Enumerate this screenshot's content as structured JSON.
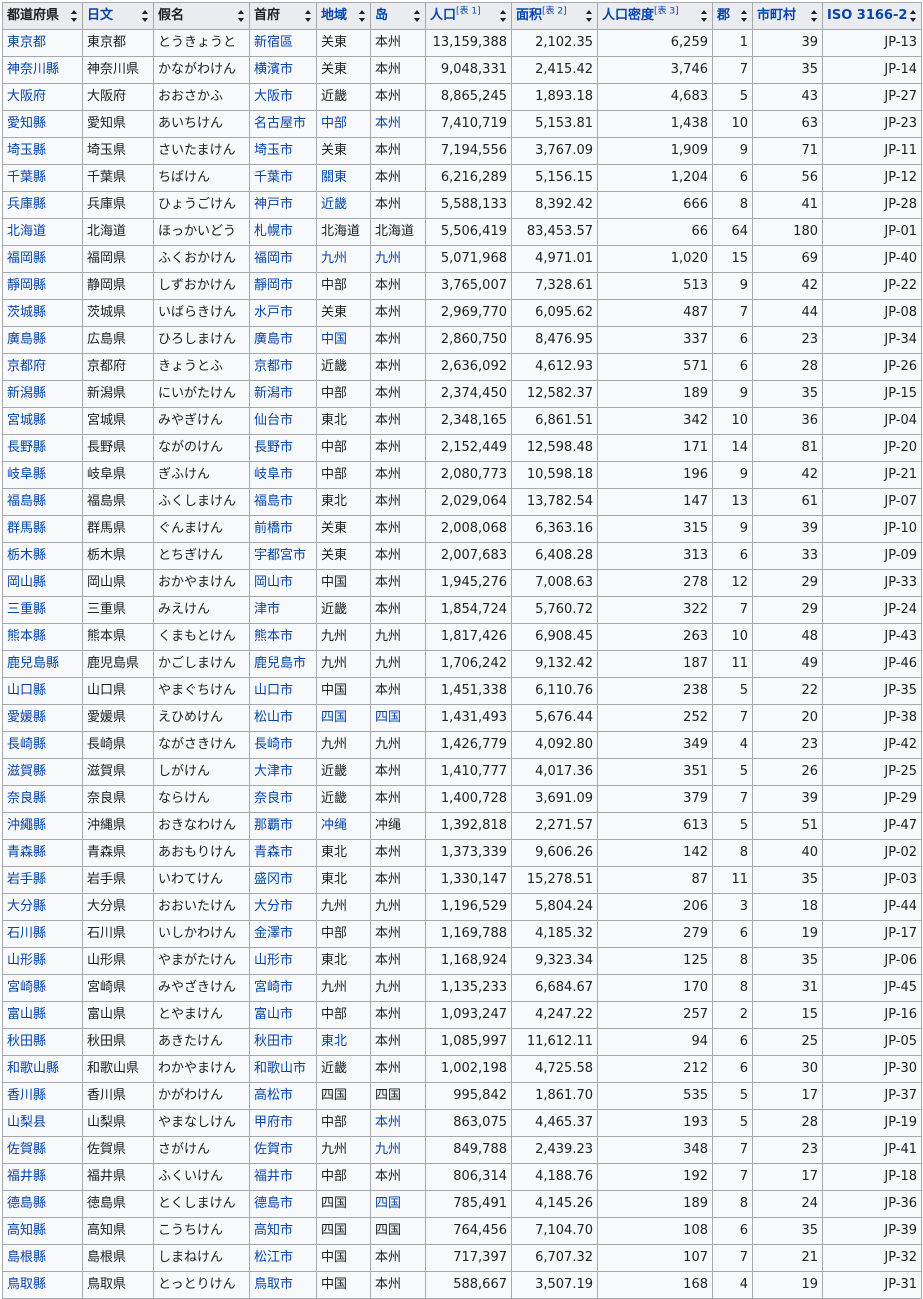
{
  "headers": [
    {
      "key": "pref",
      "label": "都道府県",
      "link": false,
      "sup": ""
    },
    {
      "key": "jp",
      "label": "日文",
      "link": true,
      "sup": ""
    },
    {
      "key": "kana",
      "label": "假名",
      "link": false,
      "sup": ""
    },
    {
      "key": "capital",
      "label": "首府",
      "link": false,
      "sup": ""
    },
    {
      "key": "region",
      "label": "地域",
      "link": true,
      "sup": ""
    },
    {
      "key": "island",
      "label": "岛",
      "link": true,
      "sup": ""
    },
    {
      "key": "pop",
      "label": "人口",
      "link": true,
      "sup": "[表 1]"
    },
    {
      "key": "area",
      "label": "面积",
      "link": true,
      "sup": "[表 2]"
    },
    {
      "key": "density",
      "label": "人口密度",
      "link": true,
      "sup": "[表 3]"
    },
    {
      "key": "districts",
      "label": "郡",
      "link": true,
      "sup": ""
    },
    {
      "key": "munis",
      "label": "市町村",
      "link": true,
      "sup": ""
    },
    {
      "key": "iso",
      "label": "ISO 3166-2",
      "link": true,
      "sup": ""
    }
  ],
  "rows": [
    {
      "pref": "東京都",
      "jp": "東京都",
      "kana": "とうきょうと",
      "capital": "新宿區",
      "region": "关東",
      "region_link": false,
      "island": "本州",
      "island_link": false,
      "pop": "13,159,388",
      "area": "2,102.35",
      "density": "6,259",
      "districts": "1",
      "munis": "39",
      "iso": "JP-13"
    },
    {
      "pref": "神奈川縣",
      "jp": "神奈川県",
      "kana": "かながわけん",
      "capital": "横濱市",
      "region": "关東",
      "region_link": false,
      "island": "本州",
      "island_link": false,
      "pop": "9,048,331",
      "area": "2,415.42",
      "density": "3,746",
      "districts": "7",
      "munis": "35",
      "iso": "JP-14"
    },
    {
      "pref": "大阪府",
      "jp": "大阪府",
      "kana": "おおさかふ",
      "capital": "大阪市",
      "region": "近畿",
      "region_link": false,
      "island": "本州",
      "island_link": false,
      "pop": "8,865,245",
      "area": "1,893.18",
      "density": "4,683",
      "districts": "5",
      "munis": "43",
      "iso": "JP-27"
    },
    {
      "pref": "愛知縣",
      "jp": "愛知県",
      "kana": "あいちけん",
      "capital": "名古屋市",
      "region": "中部",
      "region_link": true,
      "island": "本州",
      "island_link": true,
      "pop": "7,410,719",
      "area": "5,153.81",
      "density": "1,438",
      "districts": "10",
      "munis": "63",
      "iso": "JP-23"
    },
    {
      "pref": "埼玉縣",
      "jp": "埼玉県",
      "kana": "さいたまけん",
      "capital": "埼玉市",
      "region": "关東",
      "region_link": false,
      "island": "本州",
      "island_link": false,
      "pop": "7,194,556",
      "area": "3,767.09",
      "density": "1,909",
      "districts": "9",
      "munis": "71",
      "iso": "JP-11"
    },
    {
      "pref": "千葉縣",
      "jp": "千葉県",
      "kana": "ちばけん",
      "capital": "千葉市",
      "region": "關東",
      "region_link": true,
      "island": "本州",
      "island_link": false,
      "pop": "6,216,289",
      "area": "5,156.15",
      "density": "1,204",
      "districts": "6",
      "munis": "56",
      "iso": "JP-12"
    },
    {
      "pref": "兵庫縣",
      "jp": "兵庫県",
      "kana": "ひょうごけん",
      "capital": "神戸市",
      "region": "近畿",
      "region_link": true,
      "island": "本州",
      "island_link": false,
      "pop": "5,588,133",
      "area": "8,392.42",
      "density": "666",
      "districts": "8",
      "munis": "41",
      "iso": "JP-28"
    },
    {
      "pref": "北海道",
      "jp": "北海道",
      "kana": "ほっかいどう",
      "capital": "札幌市",
      "region": "北海道",
      "region_link": false,
      "island": "北海道",
      "island_link": false,
      "pop": "5,506,419",
      "area": "83,453.57",
      "density": "66",
      "districts": "64",
      "munis": "180",
      "iso": "JP-01"
    },
    {
      "pref": "福岡縣",
      "jp": "福岡県",
      "kana": "ふくおかけん",
      "capital": "福岡市",
      "region": "九州",
      "region_link": true,
      "island": "九州",
      "island_link": true,
      "pop": "5,071,968",
      "area": "4,971.01",
      "density": "1,020",
      "districts": "15",
      "munis": "69",
      "iso": "JP-40"
    },
    {
      "pref": "靜岡縣",
      "jp": "静岡県",
      "kana": "しずおかけん",
      "capital": "靜岡市",
      "region": "中部",
      "region_link": false,
      "island": "本州",
      "island_link": false,
      "pop": "3,765,007",
      "area": "7,328.61",
      "density": "513",
      "districts": "9",
      "munis": "42",
      "iso": "JP-22"
    },
    {
      "pref": "茨城縣",
      "jp": "茨城県",
      "kana": "いばらきけん",
      "capital": "水戸市",
      "region": "关東",
      "region_link": false,
      "island": "本州",
      "island_link": false,
      "pop": "2,969,770",
      "area": "6,095.62",
      "density": "487",
      "districts": "7",
      "munis": "44",
      "iso": "JP-08"
    },
    {
      "pref": "廣島縣",
      "jp": "広島県",
      "kana": "ひろしまけん",
      "capital": "廣島市",
      "region": "中国",
      "region_link": true,
      "island": "本州",
      "island_link": false,
      "pop": "2,860,750",
      "area": "8,476.95",
      "density": "337",
      "districts": "6",
      "munis": "23",
      "iso": "JP-34"
    },
    {
      "pref": "京都府",
      "jp": "京都府",
      "kana": "きょうとふ",
      "capital": "京都市",
      "region": "近畿",
      "region_link": false,
      "island": "本州",
      "island_link": false,
      "pop": "2,636,092",
      "area": "4,612.93",
      "density": "571",
      "districts": "6",
      "munis": "28",
      "iso": "JP-26"
    },
    {
      "pref": "新潟縣",
      "jp": "新潟県",
      "kana": "にいがたけん",
      "capital": "新潟市",
      "region": "中部",
      "region_link": false,
      "island": "本州",
      "island_link": false,
      "pop": "2,374,450",
      "area": "12,582.37",
      "density": "189",
      "districts": "9",
      "munis": "35",
      "iso": "JP-15"
    },
    {
      "pref": "宮城縣",
      "jp": "宮城県",
      "kana": "みやぎけん",
      "capital": "仙台市",
      "region": "東北",
      "region_link": false,
      "island": "本州",
      "island_link": false,
      "pop": "2,348,165",
      "area": "6,861.51",
      "density": "342",
      "districts": "10",
      "munis": "36",
      "iso": "JP-04"
    },
    {
      "pref": "長野縣",
      "jp": "長野県",
      "kana": "ながのけん",
      "capital": "長野市",
      "region": "中部",
      "region_link": false,
      "island": "本州",
      "island_link": false,
      "pop": "2,152,449",
      "area": "12,598.48",
      "density": "171",
      "districts": "14",
      "munis": "81",
      "iso": "JP-20"
    },
    {
      "pref": "岐阜縣",
      "jp": "岐阜県",
      "kana": "ぎふけん",
      "capital": "岐阜市",
      "region": "中部",
      "region_link": false,
      "island": "本州",
      "island_link": false,
      "pop": "2,080,773",
      "area": "10,598.18",
      "density": "196",
      "districts": "9",
      "munis": "42",
      "iso": "JP-21"
    },
    {
      "pref": "福島縣",
      "jp": "福島県",
      "kana": "ふくしまけん",
      "capital": "福島市",
      "region": "東北",
      "region_link": false,
      "island": "本州",
      "island_link": false,
      "pop": "2,029,064",
      "area": "13,782.54",
      "density": "147",
      "districts": "13",
      "munis": "61",
      "iso": "JP-07"
    },
    {
      "pref": "群馬縣",
      "jp": "群馬県",
      "kana": "ぐんまけん",
      "capital": "前橋市",
      "region": "关東",
      "region_link": false,
      "island": "本州",
      "island_link": false,
      "pop": "2,008,068",
      "area": "6,363.16",
      "density": "315",
      "districts": "9",
      "munis": "39",
      "iso": "JP-10"
    },
    {
      "pref": "栃木縣",
      "jp": "栃木県",
      "kana": "とちぎけん",
      "capital": "宇都宮市",
      "region": "关東",
      "region_link": false,
      "island": "本州",
      "island_link": false,
      "pop": "2,007,683",
      "area": "6,408.28",
      "density": "313",
      "districts": "6",
      "munis": "33",
      "iso": "JP-09"
    },
    {
      "pref": "岡山縣",
      "jp": "岡山県",
      "kana": "おかやまけん",
      "capital": "岡山市",
      "region": "中国",
      "region_link": false,
      "island": "本州",
      "island_link": false,
      "pop": "1,945,276",
      "area": "7,008.63",
      "density": "278",
      "districts": "12",
      "munis": "29",
      "iso": "JP-33"
    },
    {
      "pref": "三重縣",
      "jp": "三重県",
      "kana": "みえけん",
      "capital": "津市",
      "region": "近畿",
      "region_link": false,
      "island": "本州",
      "island_link": false,
      "pop": "1,854,724",
      "area": "5,760.72",
      "density": "322",
      "districts": "7",
      "munis": "29",
      "iso": "JP-24"
    },
    {
      "pref": "熊本縣",
      "jp": "熊本県",
      "kana": "くまもとけん",
      "capital": "熊本市",
      "region": "九州",
      "region_link": false,
      "island": "九州",
      "island_link": false,
      "pop": "1,817,426",
      "area": "6,908.45",
      "density": "263",
      "districts": "10",
      "munis": "48",
      "iso": "JP-43"
    },
    {
      "pref": "鹿兒島縣",
      "jp": "鹿児島県",
      "kana": "かごしまけん",
      "capital": "鹿兒島市",
      "region": "九州",
      "region_link": false,
      "island": "九州",
      "island_link": false,
      "pop": "1,706,242",
      "area": "9,132.42",
      "density": "187",
      "districts": "11",
      "munis": "49",
      "iso": "JP-46"
    },
    {
      "pref": "山口縣",
      "jp": "山口県",
      "kana": "やまぐちけん",
      "capital": "山口市",
      "region": "中国",
      "region_link": false,
      "island": "本州",
      "island_link": false,
      "pop": "1,451,338",
      "area": "6,110.76",
      "density": "238",
      "districts": "5",
      "munis": "22",
      "iso": "JP-35"
    },
    {
      "pref": "愛媛縣",
      "jp": "愛媛県",
      "kana": "えひめけん",
      "capital": "松山市",
      "region": "四国",
      "region_link": true,
      "island": "四国",
      "island_link": true,
      "pop": "1,431,493",
      "area": "5,676.44",
      "density": "252",
      "districts": "7",
      "munis": "20",
      "iso": "JP-38"
    },
    {
      "pref": "長崎縣",
      "jp": "長崎県",
      "kana": "ながさきけん",
      "capital": "長崎市",
      "region": "九州",
      "region_link": false,
      "island": "九州",
      "island_link": false,
      "pop": "1,426,779",
      "area": "4,092.80",
      "density": "349",
      "districts": "4",
      "munis": "23",
      "iso": "JP-42"
    },
    {
      "pref": "滋賀縣",
      "jp": "滋賀県",
      "kana": "しがけん",
      "capital": "大津市",
      "region": "近畿",
      "region_link": false,
      "island": "本州",
      "island_link": false,
      "pop": "1,410,777",
      "area": "4,017.36",
      "density": "351",
      "districts": "5",
      "munis": "26",
      "iso": "JP-25"
    },
    {
      "pref": "奈良縣",
      "jp": "奈良県",
      "kana": "ならけん",
      "capital": "奈良市",
      "region": "近畿",
      "region_link": false,
      "island": "本州",
      "island_link": false,
      "pop": "1,400,728",
      "area": "3,691.09",
      "density": "379",
      "districts": "7",
      "munis": "39",
      "iso": "JP-29"
    },
    {
      "pref": "沖繩縣",
      "jp": "沖縄県",
      "kana": "おきなわけん",
      "capital": "那覇市",
      "region": "冲绳",
      "region_link": true,
      "island": "冲绳",
      "island_link": false,
      "pop": "1,392,818",
      "area": "2,271.57",
      "density": "613",
      "districts": "5",
      "munis": "51",
      "iso": "JP-47"
    },
    {
      "pref": "青森縣",
      "jp": "青森県",
      "kana": "あおもりけん",
      "capital": "青森市",
      "region": "東北",
      "region_link": false,
      "island": "本州",
      "island_link": false,
      "pop": "1,373,339",
      "area": "9,606.26",
      "density": "142",
      "districts": "8",
      "munis": "40",
      "iso": "JP-02"
    },
    {
      "pref": "岩手縣",
      "jp": "岩手県",
      "kana": "いわてけん",
      "capital": "盛冈市",
      "region": "東北",
      "region_link": false,
      "island": "本州",
      "island_link": false,
      "pop": "1,330,147",
      "area": "15,278.51",
      "density": "87",
      "districts": "11",
      "munis": "35",
      "iso": "JP-03"
    },
    {
      "pref": "大分縣",
      "jp": "大分県",
      "kana": "おおいたけん",
      "capital": "大分市",
      "region": "九州",
      "region_link": false,
      "island": "九州",
      "island_link": false,
      "pop": "1,196,529",
      "area": "5,804.24",
      "density": "206",
      "districts": "3",
      "munis": "18",
      "iso": "JP-44"
    },
    {
      "pref": "石川縣",
      "jp": "石川県",
      "kana": "いしかわけん",
      "capital": "金澤市",
      "region": "中部",
      "region_link": false,
      "island": "本州",
      "island_link": false,
      "pop": "1,169,788",
      "area": "4,185.32",
      "density": "279",
      "districts": "6",
      "munis": "19",
      "iso": "JP-17"
    },
    {
      "pref": "山形縣",
      "jp": "山形県",
      "kana": "やまがたけん",
      "capital": "山形市",
      "region": "東北",
      "region_link": false,
      "island": "本州",
      "island_link": false,
      "pop": "1,168,924",
      "area": "9,323.34",
      "density": "125",
      "districts": "8",
      "munis": "35",
      "iso": "JP-06"
    },
    {
      "pref": "宮崎縣",
      "jp": "宮崎県",
      "kana": "みやざきけん",
      "capital": "宮崎市",
      "region": "九州",
      "region_link": false,
      "island": "九州",
      "island_link": false,
      "pop": "1,135,233",
      "area": "6,684.67",
      "density": "170",
      "districts": "8",
      "munis": "31",
      "iso": "JP-45"
    },
    {
      "pref": "富山縣",
      "jp": "富山県",
      "kana": "とやまけん",
      "capital": "富山市",
      "region": "中部",
      "region_link": false,
      "island": "本州",
      "island_link": false,
      "pop": "1,093,247",
      "area": "4,247.22",
      "density": "257",
      "districts": "2",
      "munis": "15",
      "iso": "JP-16"
    },
    {
      "pref": "秋田縣",
      "jp": "秋田県",
      "kana": "あきたけん",
      "capital": "秋田市",
      "region": "東北",
      "region_link": true,
      "island": "本州",
      "island_link": false,
      "pop": "1,085,997",
      "area": "11,612.11",
      "density": "94",
      "districts": "6",
      "munis": "25",
      "iso": "JP-05"
    },
    {
      "pref": "和歌山縣",
      "jp": "和歌山県",
      "kana": "わかやまけん",
      "capital": "和歌山市",
      "region": "近畿",
      "region_link": false,
      "island": "本州",
      "island_link": false,
      "pop": "1,002,198",
      "area": "4,725.58",
      "density": "212",
      "districts": "6",
      "munis": "30",
      "iso": "JP-30"
    },
    {
      "pref": "香川縣",
      "jp": "香川県",
      "kana": "かがわけん",
      "capital": "高松市",
      "region": "四国",
      "region_link": false,
      "island": "四国",
      "island_link": false,
      "pop": "995,842",
      "area": "1,861.70",
      "density": "535",
      "districts": "5",
      "munis": "17",
      "iso": "JP-37"
    },
    {
      "pref": "山梨县",
      "jp": "山梨県",
      "kana": "やまなしけん",
      "capital": "甲府市",
      "region": "中部",
      "region_link": false,
      "island": "本州",
      "island_link": true,
      "pop": "863,075",
      "area": "4,465.37",
      "density": "193",
      "districts": "5",
      "munis": "28",
      "iso": "JP-19"
    },
    {
      "pref": "佐賀縣",
      "jp": "佐賀県",
      "kana": "さがけん",
      "capital": "佐賀市",
      "region": "九州",
      "region_link": false,
      "island": "九州",
      "island_link": true,
      "pop": "849,788",
      "area": "2,439.23",
      "density": "348",
      "districts": "7",
      "munis": "23",
      "iso": "JP-41"
    },
    {
      "pref": "福井縣",
      "jp": "福井県",
      "kana": "ふくいけん",
      "capital": "福井市",
      "region": "中部",
      "region_link": false,
      "island": "本州",
      "island_link": false,
      "pop": "806,314",
      "area": "4,188.76",
      "density": "192",
      "districts": "7",
      "munis": "17",
      "iso": "JP-18"
    },
    {
      "pref": "德島縣",
      "jp": "徳島県",
      "kana": "とくしまけん",
      "capital": "德島市",
      "region": "四国",
      "region_link": false,
      "island": "四国",
      "island_link": true,
      "pop": "785,491",
      "area": "4,145.26",
      "density": "189",
      "districts": "8",
      "munis": "24",
      "iso": "JP-36"
    },
    {
      "pref": "高知縣",
      "jp": "高知県",
      "kana": "こうちけん",
      "capital": "高知市",
      "region": "四国",
      "region_link": false,
      "island": "四国",
      "island_link": false,
      "pop": "764,456",
      "area": "7,104.70",
      "density": "108",
      "districts": "6",
      "munis": "35",
      "iso": "JP-39"
    },
    {
      "pref": "島根縣",
      "jp": "島根県",
      "kana": "しまねけん",
      "capital": "松江市",
      "region": "中国",
      "region_link": false,
      "island": "本州",
      "island_link": false,
      "pop": "717,397",
      "area": "6,707.32",
      "density": "107",
      "districts": "7",
      "munis": "21",
      "iso": "JP-32"
    },
    {
      "pref": "鳥取縣",
      "jp": "鳥取県",
      "kana": "とっとりけん",
      "capital": "鳥取市",
      "region": "中国",
      "region_link": false,
      "island": "本州",
      "island_link": false,
      "pop": "588,667",
      "area": "3,507.19",
      "density": "168",
      "districts": "4",
      "munis": "19",
      "iso": "JP-31"
    }
  ]
}
